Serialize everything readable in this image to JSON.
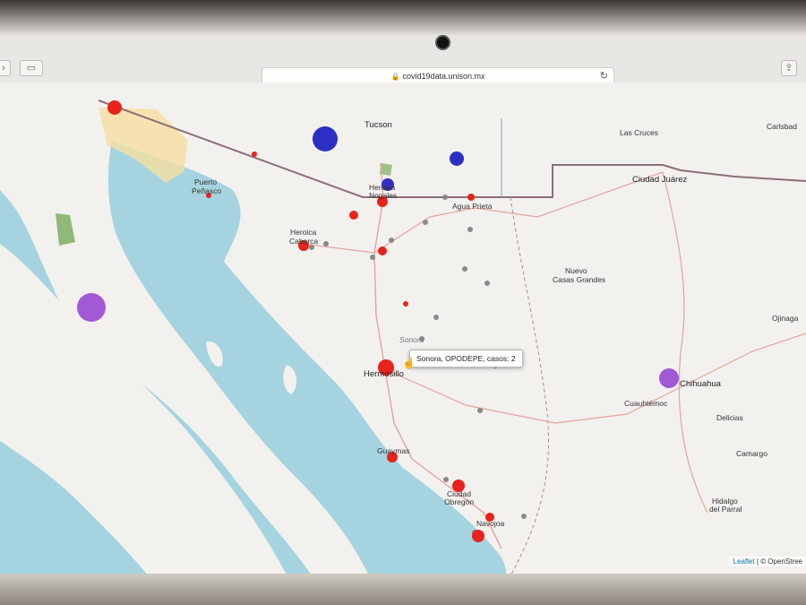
{
  "browser": {
    "url": "covid19data.unison.mx",
    "lock_icon": "lock-icon",
    "reload_icon": "reload-icon"
  },
  "map": {
    "cities": [
      {
        "id": "tucson",
        "label": "Tucson"
      },
      {
        "id": "las-cruces",
        "label": "Las Cruces"
      },
      {
        "id": "carlsbad",
        "label": "Carlsbad"
      },
      {
        "id": "puerto-penasco-1",
        "label": "Puerto"
      },
      {
        "id": "puerto-penasco-2",
        "label": "Peñasco"
      },
      {
        "id": "heroica-nogales-1",
        "label": "Heroica"
      },
      {
        "id": "heroica-nogales-2",
        "label": "Nogales"
      },
      {
        "id": "agua-prieta",
        "label": "Agua Prieta"
      },
      {
        "id": "ciudad-juarez",
        "label": "Ciudad Juárez"
      },
      {
        "id": "heroica-caborca-1",
        "label": "Heroica"
      },
      {
        "id": "heroica-caborca-2",
        "label": "Caborca"
      },
      {
        "id": "nuevo-casas-grandes-1",
        "label": "Nuevo"
      },
      {
        "id": "nuevo-casas-grandes-2",
        "label": "Casas Grandes"
      },
      {
        "id": "ojinaga",
        "label": "Ojinaga"
      },
      {
        "id": "sonora",
        "label": "Sonora"
      },
      {
        "id": "hermosillo",
        "label": "Hermosillo"
      },
      {
        "id": "chihuahua",
        "label": "Chihuahua"
      },
      {
        "id": "cuauhtemoc",
        "label": "Cuauhtémoc"
      },
      {
        "id": "delicias",
        "label": "Delicias"
      },
      {
        "id": "guaymas",
        "label": "Guaymas"
      },
      {
        "id": "camargo",
        "label": "Camargo"
      },
      {
        "id": "ciudad-obregon-1",
        "label": "Ciudad"
      },
      {
        "id": "ciudad-obregon-2",
        "label": "Obregón"
      },
      {
        "id": "hidalgo-parral-1",
        "label": "Hidalgo"
      },
      {
        "id": "hidalgo-parral-2",
        "label": "del Parral"
      },
      {
        "id": "navojoa",
        "label": "Navojoa"
      }
    ],
    "markers": [
      {
        "color": "red",
        "cases_level": 3
      },
      {
        "color": "blue",
        "cases_level": 4
      },
      {
        "color": "blue",
        "cases_level": 2
      },
      {
        "color": "blue",
        "cases_level": 2
      },
      {
        "color": "purple",
        "cases_level": 4
      },
      {
        "color": "purple",
        "cases_level": 3
      }
    ],
    "tooltip": "Sonora, OPODEPE, casos: 2",
    "attribution_leaflet": "Leaflet",
    "attribution_rest": "| © OpenStree"
  },
  "colors": {
    "marker_red": "#e8231b",
    "marker_blue": "#2d2fc4",
    "marker_purple": "#a259d6",
    "marker_gray": "#8a8a8a",
    "sea": "#a5d4e0",
    "land": "#f3f1ee",
    "border": "#8a6f78"
  }
}
